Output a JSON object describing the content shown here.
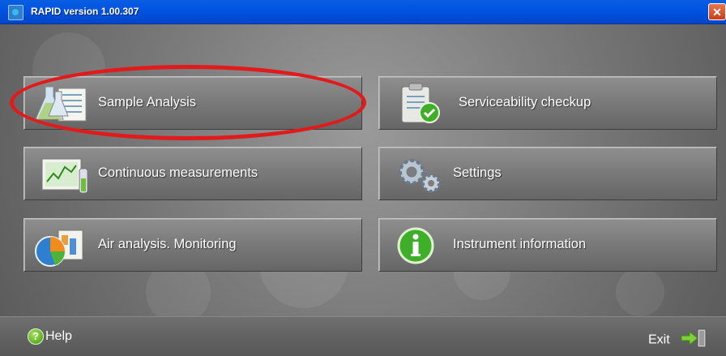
{
  "window": {
    "title": "RAPID version 1.00.307",
    "close_symbol": "✕"
  },
  "buttons": [
    {
      "label": "Sample Analysis",
      "icon": "flasks-document-icon"
    },
    {
      "label": "Serviceability checkup",
      "icon": "clipboard-check-icon"
    },
    {
      "label": "Continuous measurements",
      "icon": "chart-monitor-icon"
    },
    {
      "label": "Settings",
      "icon": "gears-icon"
    },
    {
      "label": "Air analysis. Monitoring",
      "icon": "pie-chart-icon"
    },
    {
      "label": "Instrument information",
      "icon": "info-icon"
    }
  ],
  "footer": {
    "help_label": "Help",
    "help_symbol": "?",
    "exit_label": "Exit"
  },
  "colors": {
    "titlebar": "#0054e3",
    "highlight_oval": "#e11b1b",
    "check_green": "#3fae2a"
  }
}
